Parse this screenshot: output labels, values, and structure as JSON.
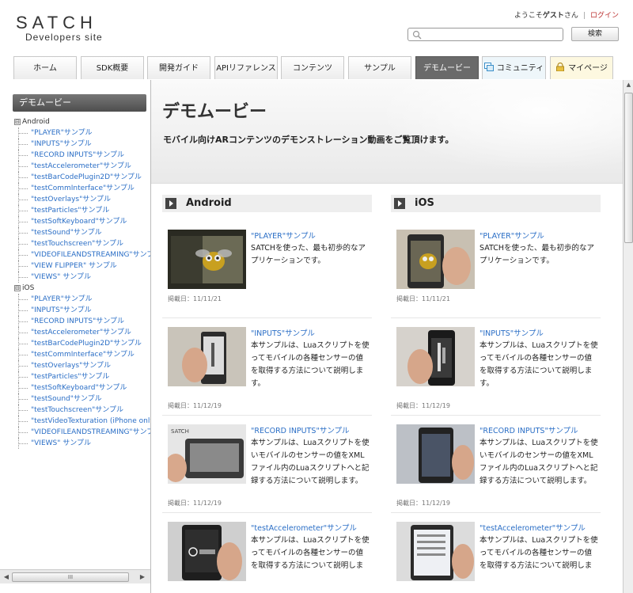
{
  "header": {
    "logo": "SATCH",
    "logo_sub": "Developers site",
    "welcome_prefix": "ようこそ",
    "guest": "ゲスト",
    "welcome_suffix": "さん",
    "separator": "|",
    "login": "ログイン",
    "search_placeholder": "",
    "search_button": "検索"
  },
  "nav": {
    "tabs": [
      {
        "label": "ホーム"
      },
      {
        "label": "SDK概要"
      },
      {
        "label": "開発ガイド"
      },
      {
        "label": "APIリファレンス"
      },
      {
        "label": "コンテンツ"
      },
      {
        "label": "サンプル"
      },
      {
        "label": "デモムービー",
        "active": true
      },
      {
        "label": "コミュニティ",
        "icon": "window-icon"
      },
      {
        "label": "マイページ",
        "icon": "lock-icon"
      }
    ]
  },
  "sidebar": {
    "title": "デモムービー",
    "groups": [
      {
        "toggle": "⊟",
        "label": "Android",
        "items": [
          "\"PLAYER\"サンプル",
          "\"INPUTS\"サンプル",
          "\"RECORD INPUTS\"サンプル",
          "\"testAccelerometer\"サンプル",
          "\"testBarCodePlugin2D\"サンプル",
          "\"testCommInterface\"サンプル",
          "\"testOverlays\"サンプル",
          "\"testParticles\"サンプル",
          "\"testSoftKeyboard\"サンプル",
          "\"testSound\"サンプル",
          "\"testTouchscreen\"サンプル",
          "\"VIDEOFILEANDSTREAMING\"サンプル",
          "\"VIEW FLIPPER\" サンプル",
          "\"VIEWS\" サンプル"
        ]
      },
      {
        "toggle": "⊟",
        "label": "iOS",
        "items": [
          "\"PLAYER\"サンプル",
          "\"INPUTS\"サンプル",
          "\"RECORD INPUTS\"サンプル",
          "\"testAccelerometer\"サンプル",
          "\"testBarCodePlugin2D\"サンプル",
          "\"testCommInterface\"サンプル",
          "\"testOverlays\"サンプル",
          "\"testParticles\"サンプル",
          "\"testSoftKeyboard\"サンプル",
          "\"testSound\"サンプル",
          "\"testTouchscreen\"サンプル",
          "\"testVideoTexturation (iPhone only)\"サンプル",
          "\"VIDEOFILEANDSTREAMING\"サンプル",
          "\"VIEWS\" サンプル"
        ]
      }
    ],
    "scroll_thumb": "III"
  },
  "main": {
    "title": "デモムービー",
    "description": "モバイル向けARコンテンツのデモンストレーション動画をご覧頂けます。",
    "columns": [
      {
        "heading": "Android",
        "cards": [
          {
            "title": "\"PLAYER\"サンプル",
            "desc": "SATCHを使った、最も初歩的なアプリケーションです。",
            "date": "掲載日：11/11/21",
            "thumb": "robot-bee"
          },
          {
            "title": "\"INPUTS\"サンプル",
            "desc": "本サンプルは、Luaスクリプトを使ってモバイルの各種センサーの値を取得する方法について説明します。",
            "date": "掲載日：11/12/19",
            "thumb": "phone-hand"
          },
          {
            "title": "\"RECORD INPUTS\"サンプル",
            "desc": "本サンプルは、Luaスクリプトを使いモバイルのセンサーの値をXMLファイル内のLuaスクリプトへと記録する方法について説明します。",
            "date": "掲載日：11/12/19",
            "thumb": "phone-dark"
          },
          {
            "title": "\"testAccelerometer\"サンプル",
            "desc": "本サンプルは、Luaスクリプトを使ってモバイルの各種センサーの値を取得する方法について説明しま",
            "date": "",
            "thumb": "phone-black"
          }
        ]
      },
      {
        "heading": "iOS",
        "cards": [
          {
            "title": "\"PLAYER\"サンプル",
            "desc": "SATCHを使った、最も初歩的なアプリケーションです。",
            "date": "掲載日：11/11/21",
            "thumb": "robot-bee-hand"
          },
          {
            "title": "\"INPUTS\"サンプル",
            "desc": "本サンプルは、Luaスクリプトを使ってモバイルの各種センサーの値を取得する方法について説明します。",
            "date": "掲載日：11/12/19",
            "thumb": "iphone-hand"
          },
          {
            "title": "\"RECORD INPUTS\"サンプル",
            "desc": "本サンプルは、Luaスクリプトを使いモバイルのセンサーの値をXMLファイル内のLuaスクリプトへと記録する方法について説明します。",
            "date": "掲載日：11/12/19",
            "thumb": "iphone-dark"
          },
          {
            "title": "\"testAccelerometer\"サンプル",
            "desc": "本サンプルは、Luaスクリプトを使ってモバイルの各種センサーの値を取得する方法について説明しま",
            "date": "",
            "thumb": "iphone-list"
          }
        ]
      }
    ]
  }
}
